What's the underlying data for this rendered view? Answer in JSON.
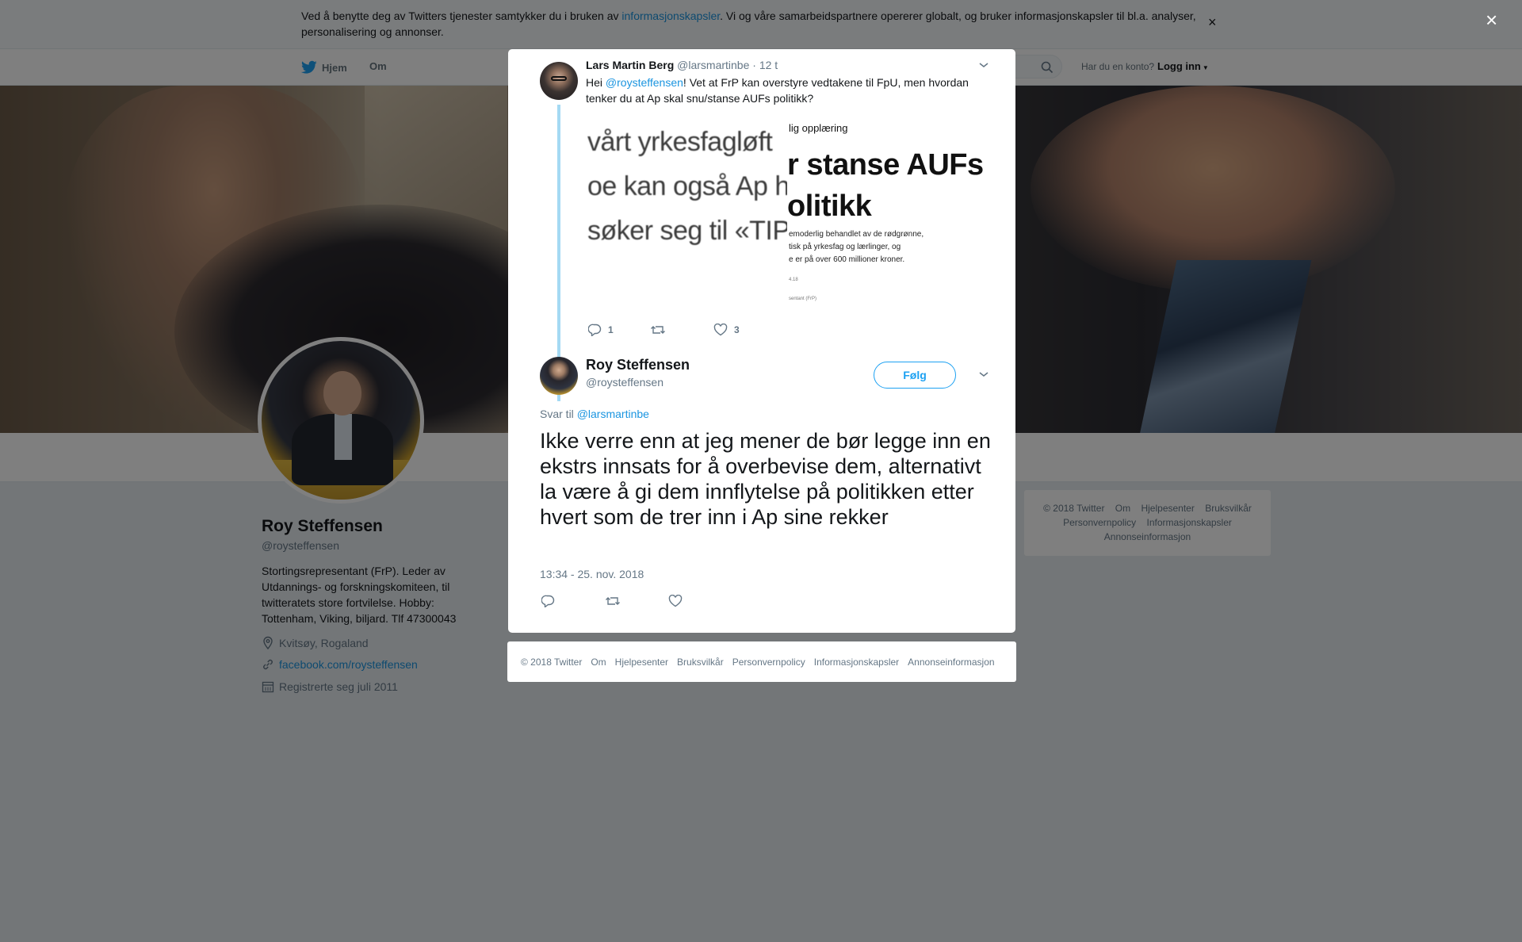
{
  "cookie": {
    "text_before": "Ved å benytte deg av Twitters tjenester samtykker du i bruken av ",
    "link": "informasjonskapsler",
    "text_after": ". Vi og våre samarbeidspartnere opererer globalt, og bruker informasjonskapsler til bl.a. analyser, personalisering og annonser.",
    "close": "×"
  },
  "nav": {
    "home": "Hjem",
    "about": "Om",
    "account_prompt": "Har du en konto?",
    "login": "Logg inn"
  },
  "profile": {
    "name": "Roy Steffensen",
    "handle": "@roysteffensen",
    "bio": "Stortingsrepresentant (FrP). Leder av Utdannings- og forskningskomiteen, til twitteratets store fortvilelse. Hobby: Tottenham, Viking, biljard. Tlf 47300043",
    "location": "Kvitsøy, Rogaland",
    "website": "facebook.com/roysteffensen",
    "joined": "Registrerte seg juli 2011"
  },
  "side_footer": {
    "items": [
      "© 2018 Twitter",
      "Om",
      "Hjelpesenter",
      "Bruksvilkår",
      "Personvernpolicy",
      "Informasjonskapsler",
      "Annonseinformasjon"
    ]
  },
  "overlay_close": "×",
  "parent_tweet": {
    "name": "Lars Martin Berg",
    "handle": "@larsmartinbe",
    "time": "· 12 t",
    "text_before": "Hei ",
    "mention": "@roysteffensen",
    "text_after": "! Vet at FrP kan overstyre vedtakene til FpU, men hvordan tenker du at Ap skal snu/stanse AUFs politikk?",
    "media_left_lines": [
      "vårt yrkesfagløft",
      "oe kan også Ap h",
      "søker seg til «TIP"
    ],
    "media_right": {
      "kicker": "lig opplæring",
      "headline_1": "r stanse AUFs",
      "headline_2": "olitikk",
      "lead_1": "emoderlig behandlet av de rødgrønne,",
      "lead_2": "tisk på yrkesfag og lærlinger, og",
      "lead_3": "e er på over 600 millioner kroner.",
      "small_1": "4.18",
      "small_2": "sentant (FrP)"
    },
    "reply_count": "1",
    "retweet_count": "",
    "like_count": "3"
  },
  "main_tweet": {
    "name": "Roy Steffensen",
    "handle": "@roysteffensen",
    "follow": "Følg",
    "reply_label": "Svar til ",
    "reply_mention": "@larsmartinbe",
    "text": "Ikke verre enn at jeg mener de bør legge inn en ekstrs innsats for å overbevise dem, alternativt la være å gi dem innflytelse på politikken etter hvert som de trer inn i Ap sine rekker",
    "timestamp": "13:34 - 25. nov. 2018"
  },
  "modal_footer": {
    "items": [
      "© 2018 Twitter",
      "Om",
      "Hjelpesenter",
      "Bruksvilkår",
      "Personvernpolicy",
      "Informasjonskapsler",
      "Annonseinformasjon"
    ]
  },
  "colors": {
    "accent": "#1da1f2",
    "link": "#1b95e0",
    "thread_line": "#a4d9f3",
    "muted": "#657786"
  }
}
